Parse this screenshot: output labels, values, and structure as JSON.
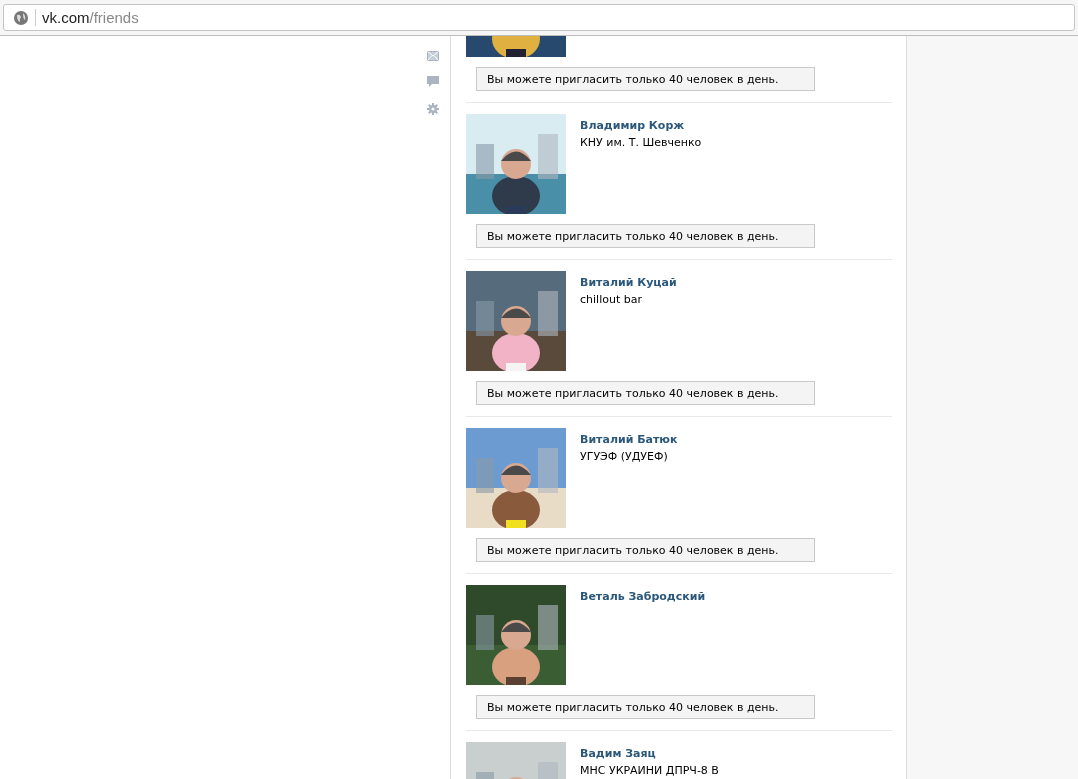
{
  "address_bar": {
    "domain": "vk.com",
    "path": "/friends"
  },
  "friends": [
    {
      "kind": "partial",
      "invite_note": "Вы можете пригласить только 40 человек в день."
    },
    {
      "kind": "full",
      "name": "Владимир Корж",
      "description": "КНУ им. Т. Шевченко",
      "invite_note": "Вы можете пригласить только 40 человек в день."
    },
    {
      "kind": "full",
      "name": "Виталий Куцай",
      "description": "chillout bar",
      "invite_note": "Вы можете пригласить только 40 человек в день."
    },
    {
      "kind": "full",
      "name": "Виталий Батюк",
      "description": "УГУЭФ (УДУЕФ)",
      "invite_note": "Вы можете пригласить только 40 человек в день."
    },
    {
      "kind": "full",
      "name": "Веталь Забродский",
      "invite_note": "Вы можете пригласить только 40 человек в день."
    },
    {
      "kind": "full",
      "name": "Вадим Заяц",
      "description": "МНС УКРАИНИ ДПРЧ-8 В"
    }
  ]
}
